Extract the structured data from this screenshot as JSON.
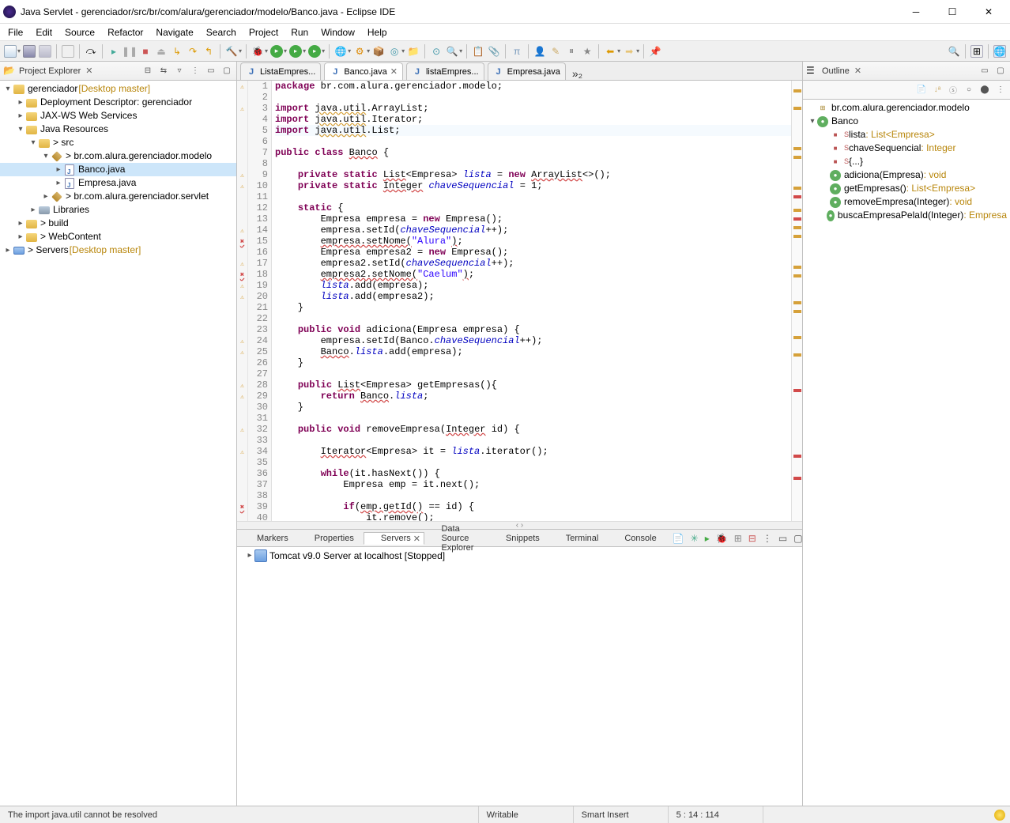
{
  "window": {
    "title": "Java Servlet - gerenciador/src/br/com/alura/gerenciador/modelo/Banco.java - Eclipse IDE"
  },
  "menu": [
    "File",
    "Edit",
    "Source",
    "Refactor",
    "Navigate",
    "Search",
    "Project",
    "Run",
    "Window",
    "Help"
  ],
  "project_explorer": {
    "title": "Project Explorer",
    "items": [
      {
        "depth": 0,
        "twisty": "v",
        "icon": "proj",
        "label": "gerenciador",
        "decor": " [Desktop master]"
      },
      {
        "depth": 1,
        "twisty": ">",
        "icon": "depl",
        "label": "Deployment Descriptor: gerenciador"
      },
      {
        "depth": 1,
        "twisty": ">",
        "icon": "jax",
        "label": "JAX-WS Web Services"
      },
      {
        "depth": 1,
        "twisty": "v",
        "icon": "jres",
        "label": "Java Resources"
      },
      {
        "depth": 2,
        "twisty": "v",
        "icon": "src",
        "label": "src",
        "decor": "",
        "prefix": "> "
      },
      {
        "depth": 3,
        "twisty": "v",
        "icon": "pkg",
        "label": "br.com.alura.gerenciador.modelo",
        "decor": "",
        "prefix": "> "
      },
      {
        "depth": 4,
        "twisty": ">",
        "icon": "jfile",
        "label": "Banco.java",
        "selected": true
      },
      {
        "depth": 4,
        "twisty": ">",
        "icon": "jfile",
        "label": "Empresa.java"
      },
      {
        "depth": 3,
        "twisty": ">",
        "icon": "pkg",
        "label": "br.com.alura.gerenciador.servlet",
        "decor": "",
        "prefix": "> "
      },
      {
        "depth": 2,
        "twisty": ">",
        "icon": "lib",
        "label": "Libraries"
      },
      {
        "depth": 1,
        "twisty": ">",
        "icon": "folder",
        "label": "build",
        "prefix": "> "
      },
      {
        "depth": 1,
        "twisty": ">",
        "icon": "folder",
        "label": "WebContent",
        "prefix": "> "
      },
      {
        "depth": 0,
        "twisty": ">",
        "icon": "server",
        "label": "Servers",
        "decor": " [Desktop master]",
        "prefix": "> "
      }
    ]
  },
  "editor_tabs": [
    {
      "label": "ListaEmpres...",
      "active": false
    },
    {
      "label": "Banco.java",
      "active": true,
      "close": true
    },
    {
      "label": "listaEmpres...",
      "active": false
    },
    {
      "label": "Empresa.java",
      "active": false
    }
  ],
  "code": {
    "lines": [
      {
        "n": 1,
        "mark": "warn",
        "html": "<span class='kw'>package</span> br.com.alura.gerenciador.modelo;"
      },
      {
        "n": 2,
        "html": ""
      },
      {
        "n": 3,
        "mark": "warn",
        "fold": "-",
        "html": "<span class='kw'>import</span> <span class='sq'>java.util</span>.ArrayList;"
      },
      {
        "n": 4,
        "html": "<span class='kw'>import</span> <span class='sq'>java.util</span>.Iterator;"
      },
      {
        "n": 5,
        "hl": true,
        "html": "<span class='kw'>import</span> <span class='sq'>java.util</span>.List;"
      },
      {
        "n": 6,
        "html": ""
      },
      {
        "n": 7,
        "html": "<span class='kw'>public</span> <span class='kw'>class</span> <span class='type err'>Banco</span> {"
      },
      {
        "n": 8,
        "html": ""
      },
      {
        "n": 9,
        "mark": "warn",
        "html": "    <span class='kw'>private</span> <span class='kw'>static</span> <span class='err'>List</span>&lt;Empresa&gt; <span class='field'>lista</span> = <span class='kw'>new</span> <span class='err'>ArrayList</span>&lt;&gt;();"
      },
      {
        "n": 10,
        "mark": "warn",
        "html": "    <span class='kw'>private</span> <span class='kw'>static</span> <span class='err'>Integer</span> <span class='field'>chaveSequencial</span> = 1;"
      },
      {
        "n": 11,
        "html": ""
      },
      {
        "n": 12,
        "fold": "-",
        "html": "    <span class='kw'>static</span> {"
      },
      {
        "n": 13,
        "html": "        Empresa empresa = <span class='kw'>new</span> Empresa();"
      },
      {
        "n": 14,
        "mark": "warn",
        "html": "        empresa.setId(<span class='field'>chaveSequencial</span>++);"
      },
      {
        "n": 15,
        "mark": "err",
        "html": "        <span class='err'>empresa.setNome(</span><span class='str'>\"Alura\"</span><span class='err'>)</span>;"
      },
      {
        "n": 16,
        "html": "        Empresa empresa2 = <span class='kw'>new</span> Empresa();"
      },
      {
        "n": 17,
        "mark": "warn",
        "html": "        empresa2.setId(<span class='field'>chaveSequencial</span>++);"
      },
      {
        "n": 18,
        "mark": "err",
        "html": "        <span class='err'>empresa2.setNome(</span><span class='str'>\"Caelum\"</span><span class='err'>)</span>;"
      },
      {
        "n": 19,
        "mark": "warn",
        "html": "        <span class='field'>lista</span>.add(empresa);"
      },
      {
        "n": 20,
        "mark": "warn",
        "html": "        <span class='field'>lista</span>.add(empresa2);"
      },
      {
        "n": 21,
        "html": "    }"
      },
      {
        "n": 22,
        "html": ""
      },
      {
        "n": 23,
        "fold": "-",
        "html": "    <span class='kw'>public</span> <span class='kw'>void</span> adiciona(Empresa empresa) {"
      },
      {
        "n": 24,
        "mark": "warn",
        "html": "        empresa.setId(Banco.<span class='field'>chaveSequencial</span>++);"
      },
      {
        "n": 25,
        "mark": "warn",
        "html": "        <span class='err'>Banco</span>.<span class='field'>lista</span>.add(empresa);"
      },
      {
        "n": 26,
        "html": "    }"
      },
      {
        "n": 27,
        "html": ""
      },
      {
        "n": 28,
        "mark": "warn",
        "fold": "-",
        "html": "    <span class='kw'>public</span> <span class='err'>List</span>&lt;Empresa&gt; getEmpresas(){"
      },
      {
        "n": 29,
        "mark": "warn",
        "html": "        <span class='kw'>return</span> <span class='err'>Banco</span>.<span class='field'>lista</span>;"
      },
      {
        "n": 30,
        "html": "    }"
      },
      {
        "n": 31,
        "html": ""
      },
      {
        "n": 32,
        "mark": "warn",
        "fold": "-",
        "html": "    <span class='kw'>public</span> <span class='kw'>void</span> removeEmpresa(<span class='err'>Integer</span> id) {"
      },
      {
        "n": 33,
        "html": ""
      },
      {
        "n": 34,
        "mark": "warn",
        "html": "        <span class='err'>Iterator</span>&lt;Empresa&gt; it = <span class='field'>lista</span>.iterator();"
      },
      {
        "n": 35,
        "html": ""
      },
      {
        "n": 36,
        "html": "        <span class='kw'>while</span>(it.hasNext()) {"
      },
      {
        "n": 37,
        "html": "            Empresa emp = it.next();"
      },
      {
        "n": 38,
        "html": ""
      },
      {
        "n": 39,
        "mark": "err",
        "html": "            <span class='kw'>if</span>(<span class='err'>emp.getId()</span> == id) {"
      },
      {
        "n": 40,
        "html": "                it.remove();"
      }
    ]
  },
  "outline": {
    "title": "Outline",
    "items": [
      {
        "depth": 0,
        "icon": "pkg",
        "label": "br.com.alura.gerenciador.modelo"
      },
      {
        "depth": 0,
        "twisty": "v",
        "icon": "cls",
        "label": "Banco"
      },
      {
        "depth": 1,
        "icon": "fld",
        "sup": "S",
        "label": "lista",
        "tail": " : List<Empresa>"
      },
      {
        "depth": 1,
        "icon": "fld",
        "sup": "S",
        "label": "chaveSequencial",
        "tail": " : Integer"
      },
      {
        "depth": 1,
        "icon": "fld",
        "sup": "S",
        "label": "{...}"
      },
      {
        "depth": 1,
        "icon": "meth",
        "label": "adiciona(Empresa)",
        "tail": " : void"
      },
      {
        "depth": 1,
        "icon": "meth",
        "label": "getEmpresas()",
        "tail": " : List<Empresa>"
      },
      {
        "depth": 1,
        "icon": "meth",
        "label": "removeEmpresa(Integer)",
        "tail": " : void"
      },
      {
        "depth": 1,
        "icon": "meth",
        "label": "buscaEmpresaPelaId(Integer)",
        "tail": " : Empresa"
      }
    ]
  },
  "bottom": {
    "tabs": [
      {
        "label": "Markers"
      },
      {
        "label": "Properties"
      },
      {
        "label": "Servers",
        "active": true,
        "close": true
      },
      {
        "label": "Data Source Explorer"
      },
      {
        "label": "Snippets"
      },
      {
        "label": "Terminal"
      },
      {
        "label": "Console"
      }
    ],
    "server_row": "Tomcat v9.0 Server at localhost  [Stopped]"
  },
  "status": {
    "message": "The import java.util cannot be resolved",
    "writable": "Writable",
    "insert": "Smart Insert",
    "cursor": "5 : 14 : 114"
  }
}
